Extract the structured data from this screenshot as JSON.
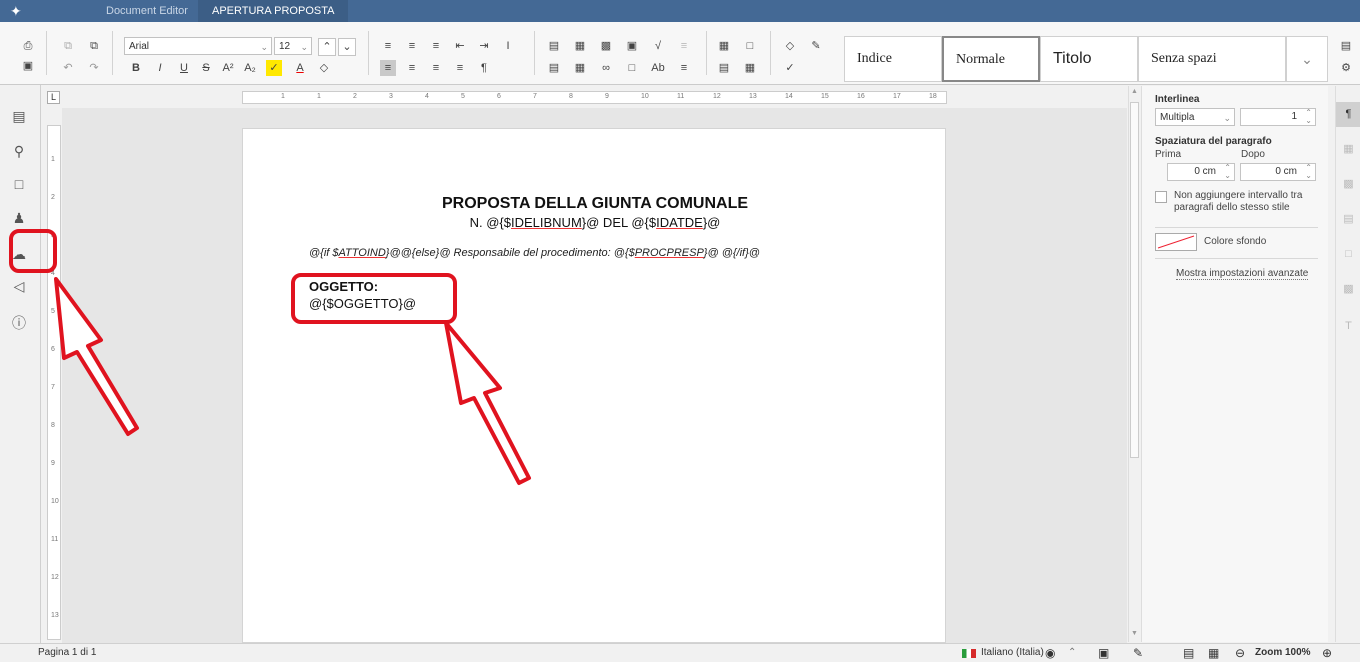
{
  "titlebar": {
    "tabs": [
      "Document Editor",
      "APERTURA PROPOSTA"
    ]
  },
  "toolbar": {
    "font_name": "Arial",
    "font_size": "12",
    "styles": [
      "Indice",
      "Normale",
      "Titolo",
      "Senza spazi"
    ]
  },
  "document": {
    "title": "PROPOSTA DELLA GIUNTA COMUNALE",
    "subtitle_pre": "N. @{$",
    "subtitle_field1": "IDELIBNUM",
    "subtitle_mid": "}@ DEL @{$",
    "subtitle_field2": "IDATDE",
    "subtitle_post": "}@",
    "line_pre": "@{if $",
    "line_field1": "ATTOIND",
    "line_mid": "}@@{else}@ Responsabile del procedimento: @{$",
    "line_field2": "PROCPRESP",
    "line_post": "}@ @{/if}@",
    "oggetto_label": "OGGETTO:",
    "oggetto_value": "@{$OGGETTO}@"
  },
  "panel": {
    "interlinea_label": "Interlinea",
    "interlinea_mode": "Multipla",
    "interlinea_value": "1",
    "spaziatura_label": "Spaziatura del paragrafo",
    "prima_label": "Prima",
    "dopo_label": "Dopo",
    "prima_value": "0 cm",
    "dopo_value": "0 cm",
    "checkbox_label": "Non aggiungere intervallo tra paragrafi dello stesso stile",
    "colore_label": "Colore sfondo",
    "advanced_label": "Mostra impostazioni avanzate"
  },
  "status": {
    "page": "Pagina 1 di 1",
    "language": "Italiano (Italia)",
    "zoom": "Zoom 100%"
  },
  "ruler": {
    "h_numbers": [
      "1",
      "1",
      "2",
      "3",
      "4",
      "5",
      "6",
      "7",
      "8",
      "9",
      "10",
      "11",
      "12",
      "13",
      "14",
      "15",
      "16",
      "17",
      "18"
    ],
    "v_numbers": [
      "1",
      "2",
      "3",
      "4",
      "5",
      "6",
      "7",
      "8",
      "9",
      "10",
      "11",
      "12",
      "13"
    ]
  },
  "colors": {
    "titlebar": "#446995",
    "annotation": "#e0131f"
  }
}
